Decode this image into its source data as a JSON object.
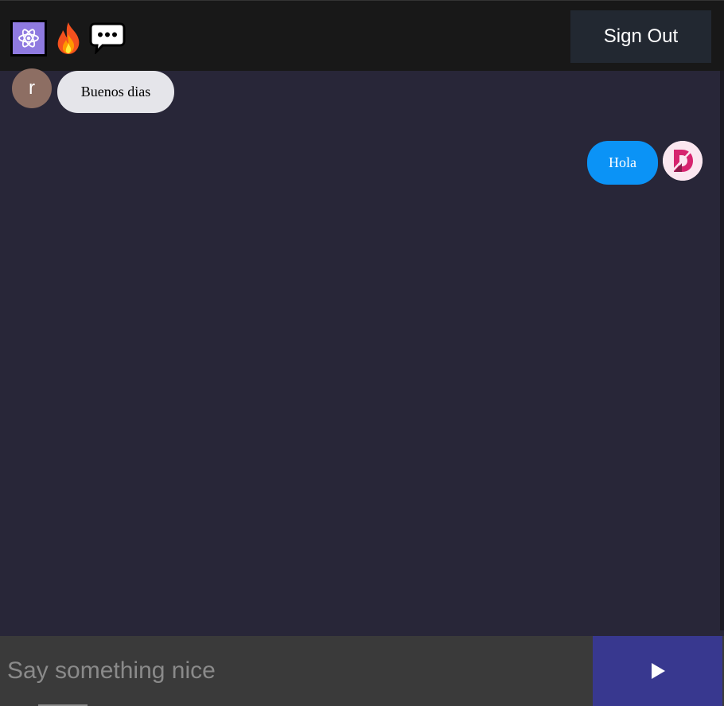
{
  "header": {
    "logos": [
      {
        "icon": "atom-icon"
      },
      {
        "icon": "fire-icon"
      },
      {
        "icon": "speech-bubble-icon"
      }
    ],
    "signout_label": "Sign Out"
  },
  "messages": [
    {
      "type": "received",
      "avatar_letter": "r",
      "text": "Buenos dias"
    },
    {
      "type": "sent",
      "avatar_icon": "d-logo-icon",
      "text": "Hola"
    }
  ],
  "composer": {
    "placeholder": "Say something nice",
    "value": "",
    "send_icon": "play-icon"
  },
  "colors": {
    "header_bg": "#181818",
    "chat_bg": "#282638",
    "received_bubble": "#e5e5ea",
    "sent_bubble": "#0b93f6",
    "send_button": "#38388f",
    "avatar_r": "#8d6e63"
  }
}
